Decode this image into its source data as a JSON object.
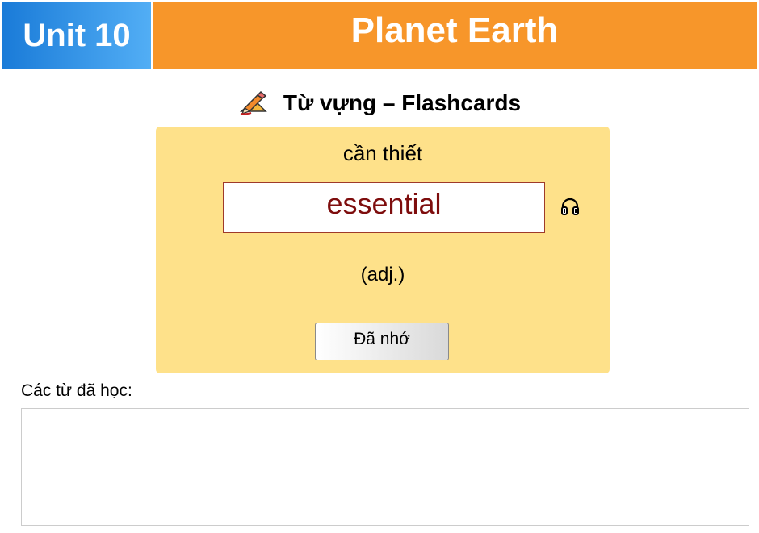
{
  "header": {
    "unit_label": "Unit 10",
    "title": "Planet Earth",
    "unit_color": "#2b8fe6",
    "title_color": "#f7962a"
  },
  "section": {
    "icon": "pencil-writing-icon",
    "heading": "Từ vựng – Flashcards"
  },
  "flashcard": {
    "meaning": "cần thiết",
    "word": "essential",
    "part_of_speech": "(adj.)",
    "audio_icon": "headphones-icon",
    "remember_label": "Đã nhớ",
    "card_color": "#fee18a",
    "word_color": "#7e0d0d"
  },
  "learned": {
    "label": "Các từ đã học:",
    "words": []
  }
}
